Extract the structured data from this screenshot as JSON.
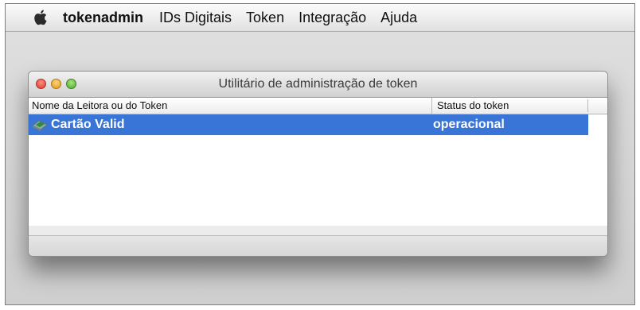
{
  "menubar": {
    "apple_icon": "apple-logo",
    "app_name": "tokenadmin",
    "items": [
      "IDs Digitais",
      "Token",
      "Integração",
      "Ajuda"
    ]
  },
  "window": {
    "title": "Utilitário de administração de token",
    "columns": {
      "name": "Nome da Leitora ou do Token",
      "status": "Status do token"
    },
    "rows": [
      {
        "icon": "smart-card-reader-icon",
        "name": "Cartão Valid",
        "status": "operacional",
        "selected": true
      }
    ]
  },
  "colors": {
    "selection": "#3875d7",
    "close": "#e14a3d",
    "minimize": "#f0b02a",
    "maximize": "#6cc543"
  }
}
